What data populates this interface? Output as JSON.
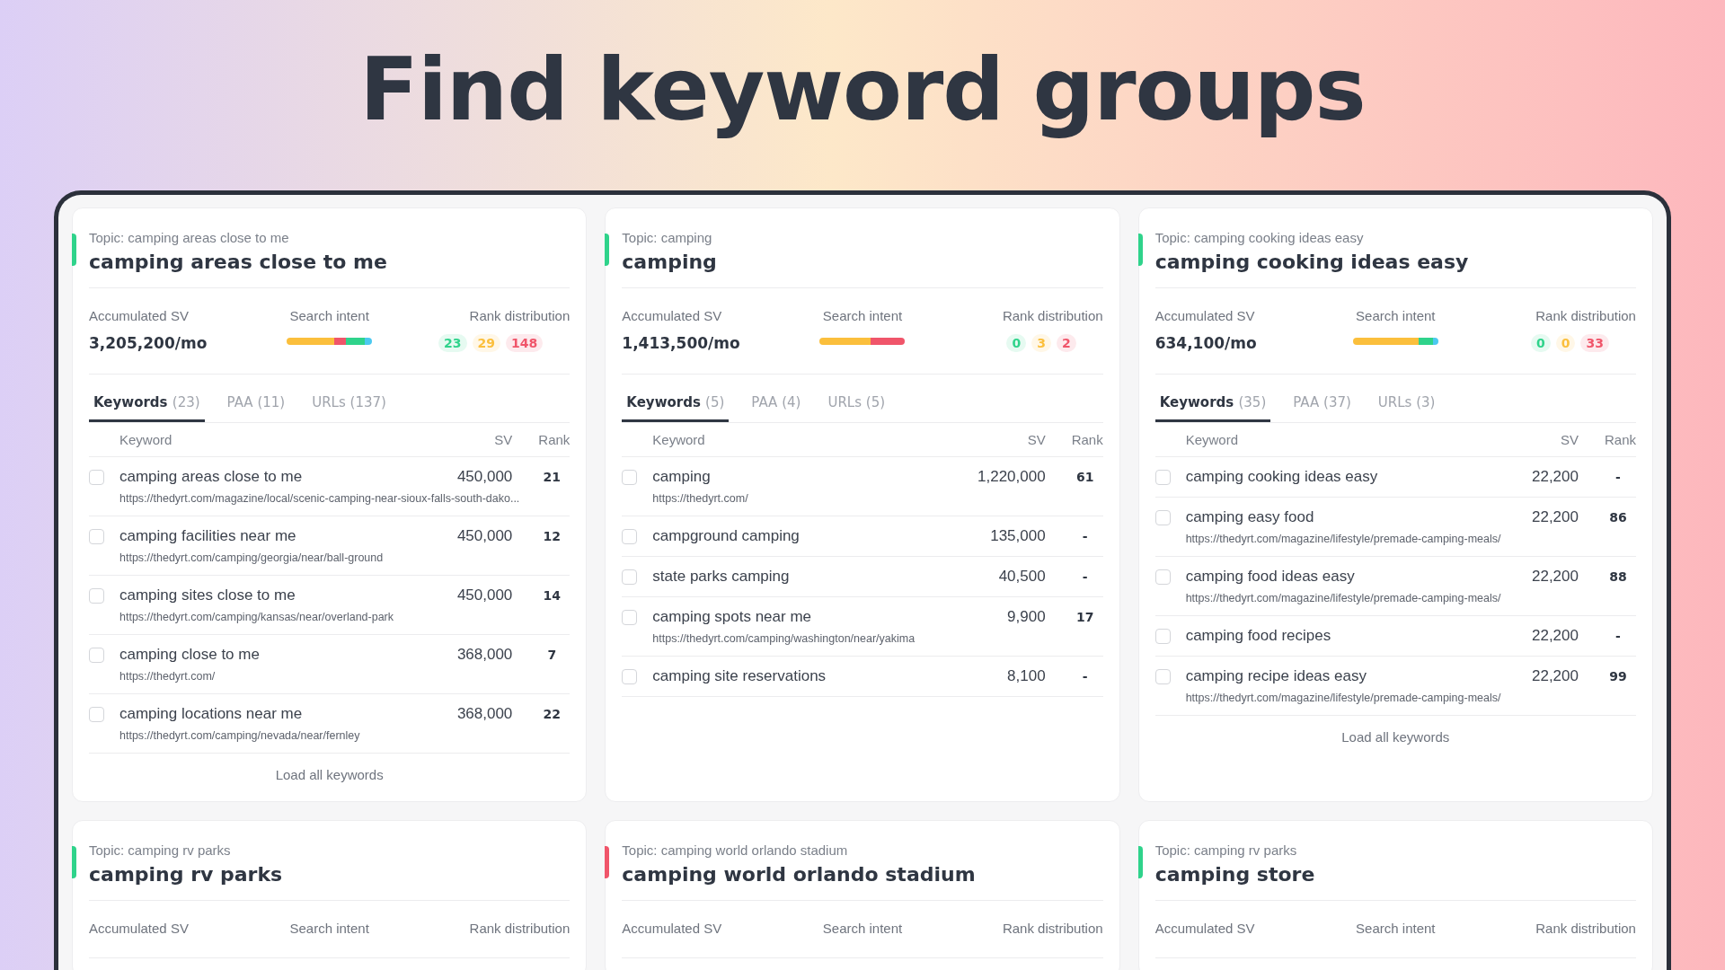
{
  "headline": "Find keyword groups",
  "cards": [
    {
      "color": "#2fd38b",
      "topic": "Topic: camping areas close to me",
      "title": "camping areas close to me",
      "stats": {
        "sv_label": "Accumulated SV",
        "sv_value": "3,205,200/mo",
        "intent_label": "Search intent",
        "rank_label": "Rank distribution"
      },
      "intent": [
        {
          "color": "#fbbf3c"
        },
        {
          "color": "#f0556a"
        },
        {
          "color": "#2fd38b"
        },
        {
          "color": "#4cc9f0"
        }
      ],
      "ranks": [
        {
          "value": "23",
          "color": "#2fd38b"
        },
        {
          "value": "29",
          "color": "#fbbf3c"
        },
        {
          "value": "148",
          "color": "#f0556a"
        }
      ],
      "tabs": [
        {
          "label": "Keywords",
          "count": "(23)",
          "selected": true
        },
        {
          "label": "PAA",
          "count": "(11)",
          "selected": false
        },
        {
          "label": "URLs",
          "count": "(137)",
          "selected": false
        }
      ],
      "columns": [
        "Keyword",
        "SV",
        "Rank"
      ],
      "rows": [
        {
          "keyword": "camping areas close to me",
          "sv": "450,000",
          "rank": "21",
          "url": "https://thedyrt.com/magazine/local/scenic-camping-near-sioux-falls-south-dako...",
          "checked": false
        },
        {
          "keyword": "camping facilities near me",
          "sv": "450,000",
          "rank": "12",
          "url": "https://thedyrt.com/camping/georgia/near/ball-ground",
          "checked": false
        },
        {
          "keyword": "camping sites close to me",
          "sv": "450,000",
          "rank": "14",
          "url": "https://thedyrt.com/camping/kansas/near/overland-park",
          "checked": false
        },
        {
          "keyword": "camping close to me",
          "sv": "368,000",
          "rank": "7",
          "url": "https://thedyrt.com/",
          "checked": false
        },
        {
          "keyword": "camping locations near me",
          "sv": "368,000",
          "rank": "22",
          "url": "https://thedyrt.com/camping/nevada/near/fernley",
          "checked": false
        }
      ],
      "load_more": "Load all keywords"
    },
    {
      "color": "#2fd38b",
      "topic": "Topic: camping",
      "title": "camping",
      "stats": {
        "sv_label": "Accumulated SV",
        "sv_value": "1,413,500/mo",
        "intent_label": "Search intent",
        "rank_label": "Rank distribution"
      },
      "intent": [
        {
          "color": "#fbbf3c"
        },
        {
          "color": "#f0556a"
        }
      ],
      "ranks": [
        {
          "value": "0",
          "color": "#2fd38b"
        },
        {
          "value": "3",
          "color": "#fbbf3c"
        },
        {
          "value": "2",
          "color": "#f0556a"
        }
      ],
      "tabs": [
        {
          "label": "Keywords",
          "count": "(5)",
          "selected": true
        },
        {
          "label": "PAA",
          "count": "(4)",
          "selected": false
        },
        {
          "label": "URLs",
          "count": "(5)",
          "selected": false
        }
      ],
      "columns": [
        "Keyword",
        "SV",
        "Rank"
      ],
      "rows": [
        {
          "keyword": "camping",
          "sv": "1,220,000",
          "rank": "61",
          "url": "https://thedyrt.com/",
          "checked": false
        },
        {
          "keyword": "campground camping",
          "sv": "135,000",
          "rank": "-",
          "checked": false
        },
        {
          "keyword": "state parks camping",
          "sv": "40,500",
          "rank": "-",
          "checked": false
        },
        {
          "keyword": "camping spots near me",
          "sv": "9,900",
          "rank": "17",
          "url": "https://thedyrt.com/camping/washington/near/yakima",
          "checked": false
        },
        {
          "keyword": "camping site reservations",
          "sv": "8,100",
          "rank": "-",
          "checked": false
        }
      ]
    },
    {
      "color": "#2fd38b",
      "topic": "Topic: camping cooking ideas easy",
      "title": "camping cooking ideas easy",
      "stats": {
        "sv_label": "Accumulated SV",
        "sv_value": "634,100/mo",
        "intent_label": "Search intent",
        "rank_label": "Rank distribution"
      },
      "intent": [
        {
          "color": "#fbbf3c"
        },
        {
          "color": "#2fd38b"
        },
        {
          "color": "#4cc9f0"
        }
      ],
      "ranks": [
        {
          "value": "0",
          "color": "#2fd38b"
        },
        {
          "value": "0",
          "color": "#fbbf3c"
        },
        {
          "value": "33",
          "color": "#f0556a"
        }
      ],
      "tabs": [
        {
          "label": "Keywords",
          "count": "(35)",
          "selected": true
        },
        {
          "label": "PAA",
          "count": "(37)",
          "selected": false
        },
        {
          "label": "URLs",
          "count": "(3)",
          "selected": false
        }
      ],
      "columns": [
        "Keyword",
        "SV",
        "Rank"
      ],
      "rows": [
        {
          "keyword": "camping cooking ideas easy",
          "sv": "22,200",
          "rank": "-",
          "checked": false
        },
        {
          "keyword": "camping easy food",
          "sv": "22,200",
          "rank": "86",
          "url": "https://thedyrt.com/magazine/lifestyle/premade-camping-meals/",
          "checked": false
        },
        {
          "keyword": "camping food ideas easy",
          "sv": "22,200",
          "rank": "88",
          "url": "https://thedyrt.com/magazine/lifestyle/premade-camping-meals/",
          "checked": false
        },
        {
          "keyword": "camping food recipes",
          "sv": "22,200",
          "rank": "-",
          "checked": false
        },
        {
          "keyword": "camping recipe ideas easy",
          "sv": "22,200",
          "rank": "99",
          "url": "https://thedyrt.com/magazine/lifestyle/premade-camping-meals/",
          "checked": false
        }
      ],
      "load_more": "Load all keywords"
    },
    {
      "color": "#2fd38b",
      "topic": "Topic: camping rv parks",
      "title": "camping rv parks",
      "stats": {
        "sv_label": "Accumulated SV",
        "intent_label": "Search intent",
        "rank_label": "Rank distribution"
      }
    },
    {
      "color": "#f0556a",
      "topic": "Topic: camping world orlando stadium",
      "title": "camping world orlando stadium",
      "stats": {
        "sv_label": "Accumulated SV",
        "intent_label": "Search intent",
        "rank_label": "Rank distribution"
      }
    },
    {
      "color": "#2fd38b",
      "topic": "Topic: camping rv parks",
      "title": "camping store",
      "stats": {
        "sv_label": "Accumulated SV",
        "intent_label": "Search intent",
        "rank_label": "Rank distribution"
      }
    }
  ]
}
